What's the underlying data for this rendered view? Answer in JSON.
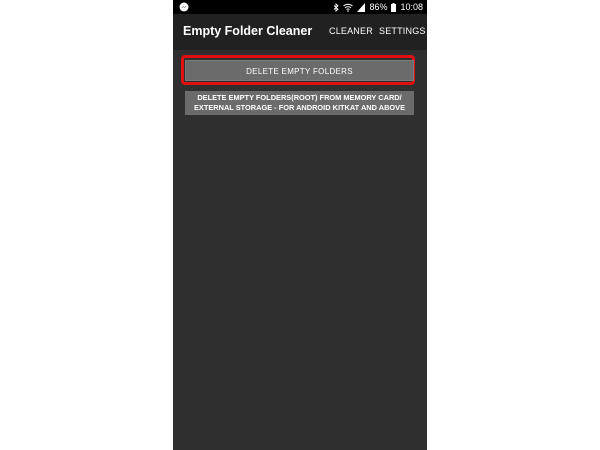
{
  "status_bar": {
    "battery_percent": "86%",
    "time": "10:08",
    "icons": [
      "messenger-icon",
      "bluetooth-icon",
      "wifi-icon",
      "signal-icon",
      "battery-icon"
    ]
  },
  "app_bar": {
    "title": "Empty Folder Cleaner",
    "menu": {
      "cleaner": "CLEANER",
      "settings": "SETTINGS"
    }
  },
  "main": {
    "delete_button_label": "DELETE  EMPTY  FOLDERS",
    "root_button_line1": "DELETE EMPTY FOLDERS(ROOT) FROM MEMORY CARD/",
    "root_button_line2": "EXTERNAL STORAGE - FOR ANDROID KITKAT AND ABOVE"
  },
  "colors": {
    "background": "#2f2f2f",
    "app_bar": "#212121",
    "status_bar": "#000000",
    "button": "#6b6b6b",
    "highlight": "#e01010"
  }
}
